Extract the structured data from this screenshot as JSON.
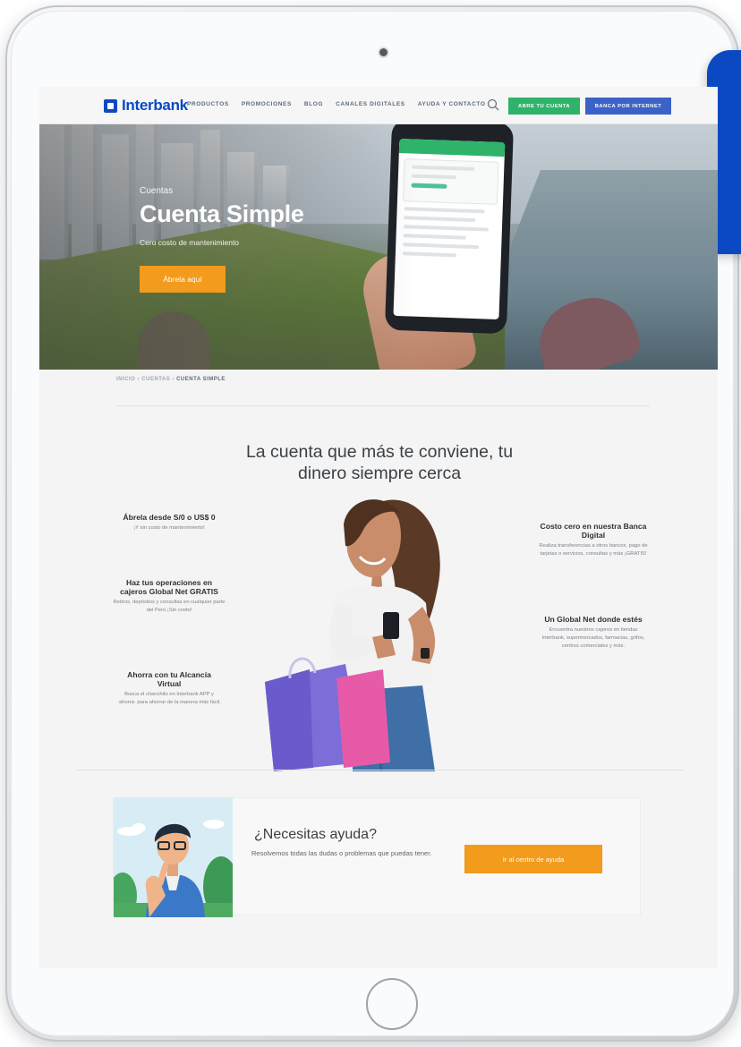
{
  "brand": {
    "name": "Interbank",
    "blue": "#0a49c2",
    "green": "#2fb36b",
    "orange": "#f29b1c"
  },
  "nav": {
    "items": [
      "PRODUCTOS",
      "PROMOCIONES",
      "BLOG",
      "CANALES DIGITALES",
      "AYUDA Y CONTACTO"
    ],
    "search_icon": "search-icon",
    "cta_green": "ABRE TU CUENTA",
    "cta_blue": "BANCA POR INTERNET"
  },
  "hero": {
    "eyebrow": "Cuentas",
    "title": "Cuenta Simple",
    "subtitle": "Cero costo de mantenimiento",
    "button": "Ábrela aquí"
  },
  "breadcrumb": {
    "items": [
      "INICIO",
      "CUENTAS"
    ],
    "current": "CUENTA SIMPLE",
    "separator": " › "
  },
  "heading": {
    "line1": "La cuenta que más te conviene, tu",
    "line2": "dinero siempre cerca"
  },
  "features_left": [
    {
      "title": "Ábrela desde S/0 o US$ 0",
      "desc": "¡Y sin costo de mantenimiento!"
    },
    {
      "title": "Haz tus operaciones en cajeros Global Net GRATIS",
      "desc": "Retiros, depósitos y consultas en cualquier parte del Perú ¡Sin costo!"
    },
    {
      "title": "Ahorra con tu Alcancía Virtual",
      "desc": "Busca el chanchito en Interbank APP y ·ahorra· para ahorrar de la manera más fácil."
    }
  ],
  "features_right": [
    {
      "title": "Costo cero en nuestra Banca Digital",
      "desc": "Realiza transferencias a otros bancos, pago de tarjetas o servicios, consultas y más ¡GRATIS!"
    },
    {
      "title": "Un Global Net donde estés",
      "desc": "Encuentra nuestros cajeros en tiendas Interbank, supermercados, farmacias, grifos, centros comerciales y más."
    }
  ],
  "help": {
    "title": "¿Necesitas ayuda?",
    "desc": "Resolvemos todas las dudas o problemas que puedas tener.",
    "button": "Ir al centro de ayuda"
  }
}
